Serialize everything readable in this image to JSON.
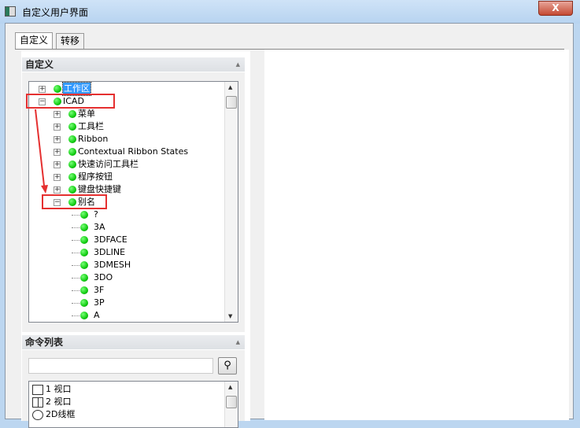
{
  "window": {
    "title": "自定义用户界面",
    "close_label": "X"
  },
  "tabs": [
    {
      "label": "自定义",
      "active": true
    },
    {
      "label": "转移",
      "active": false
    }
  ],
  "customize_section": {
    "title": "自定义",
    "tree": [
      {
        "label": "工作区",
        "level": 0,
        "expander": "+",
        "selected": true
      },
      {
        "label": "ICAD",
        "level": 0,
        "expander": "-",
        "highlighted": true
      },
      {
        "label": "菜单",
        "level": 1,
        "expander": "+"
      },
      {
        "label": "工具栏",
        "level": 1,
        "expander": "+"
      },
      {
        "label": "Ribbon",
        "level": 1,
        "expander": "+"
      },
      {
        "label": "Contextual Ribbon States",
        "level": 1,
        "expander": "+"
      },
      {
        "label": "快速访问工具栏",
        "level": 1,
        "expander": "+"
      },
      {
        "label": "程序按钮",
        "level": 1,
        "expander": "+"
      },
      {
        "label": "键盘快捷键",
        "level": 1,
        "expander": "+"
      },
      {
        "label": "别名",
        "level": 1,
        "expander": "-",
        "highlighted": true
      },
      {
        "label": "?",
        "level": 2
      },
      {
        "label": "3A",
        "level": 2
      },
      {
        "label": "3DFACE",
        "level": 2
      },
      {
        "label": "3DLINE",
        "level": 2
      },
      {
        "label": "3DMESH",
        "level": 2
      },
      {
        "label": "3DO",
        "level": 2
      },
      {
        "label": "3F",
        "level": 2
      },
      {
        "label": "3P",
        "level": 2
      },
      {
        "label": "A",
        "level": 2
      }
    ]
  },
  "command_list": {
    "title": "命令列表",
    "search_value": "",
    "search_icon": "binoculars-icon",
    "items": [
      {
        "label": "1 视口",
        "icon": "single-viewport-icon"
      },
      {
        "label": "2 视口",
        "icon": "two-viewport-icon"
      },
      {
        "label": "2D线框",
        "icon": "circle-icon"
      }
    ]
  },
  "colors": {
    "annotation": "#e53030",
    "node_dot": "#22cc22",
    "selection": "#3399ff"
  }
}
